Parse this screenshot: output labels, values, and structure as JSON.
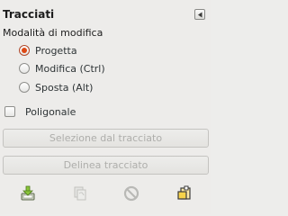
{
  "panel": {
    "title": "Tracciati",
    "collapse_icon": "triangle-left-icon"
  },
  "mode": {
    "label": "Modalità di modifica",
    "options": [
      {
        "label": "Progetta",
        "checked": true
      },
      {
        "label": "Modifica (Ctrl)",
        "checked": false
      },
      {
        "label": "Sposta (Alt)",
        "checked": false
      }
    ]
  },
  "polygonal": {
    "label": "Poligonale",
    "checked": false
  },
  "buttons": {
    "selection_from_path": "Selezione dal tracciato",
    "stroke_path": "Delinea tracciato"
  },
  "toolbar": {
    "icons": [
      "import-path-icon",
      "copy-path-icon",
      "cancel-icon",
      "reset-path-icon"
    ]
  },
  "colors": {
    "accent": "#dd4814",
    "background": "#edecea",
    "disabled_text": "#aeaeab"
  }
}
